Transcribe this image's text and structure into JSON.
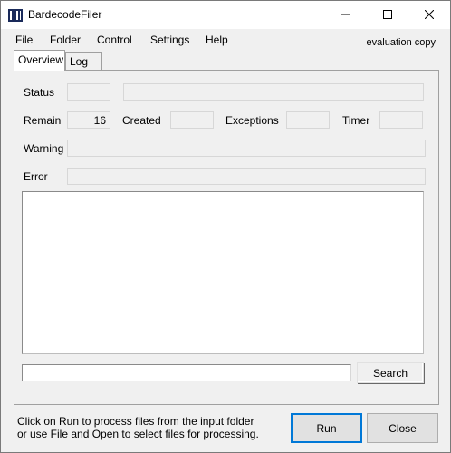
{
  "window": {
    "title": "BardecodeFiler"
  },
  "menu": {
    "items": [
      "File",
      "Folder",
      "Control",
      "Settings",
      "Help"
    ]
  },
  "banner": "evaluation copy",
  "tabs": [
    {
      "label": "Overview",
      "active": true
    },
    {
      "label": "Log",
      "active": false
    }
  ],
  "overview": {
    "status_label": "Status",
    "status_value": "",
    "status_text": "",
    "remain_label": "Remain",
    "remain_value": "16",
    "created_label": "Created",
    "created_value": "",
    "exceptions_label": "Exceptions",
    "exceptions_value": "",
    "timer_label": "Timer",
    "timer_value": "",
    "warning_label": "Warning",
    "warning_value": "",
    "error_label": "Error",
    "error_value": "",
    "log_text": "",
    "search_value": "",
    "search_label": "Search"
  },
  "footer": {
    "hint_line1": "Click on Run to process files from the input folder",
    "hint_line2": "or use File and Open to select files for processing.",
    "run_label": "Run",
    "close_label": "Close"
  }
}
